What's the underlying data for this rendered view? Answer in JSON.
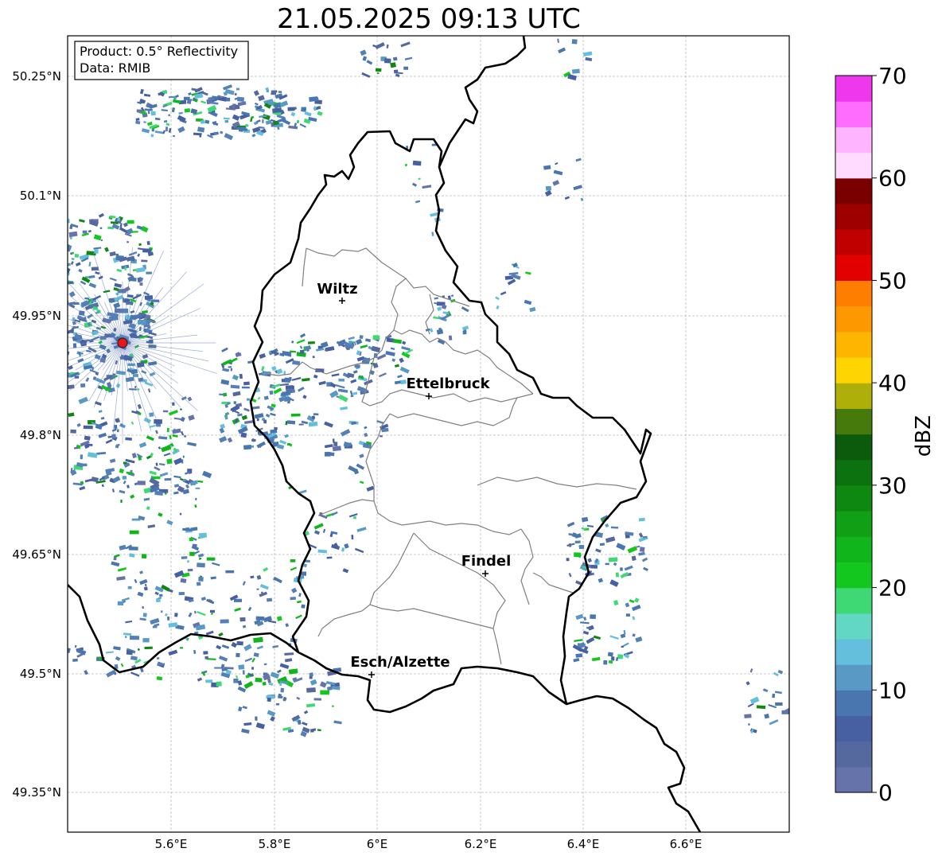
{
  "title": "21.05.2025 09:13 UTC",
  "info_box": {
    "product": "Product: 0.5° Reflectivity",
    "data": "Data: RMIB"
  },
  "lat_ticks": [
    "50.25°N",
    "50.1°N",
    "49.95°N",
    "49.8°N",
    "49.65°N",
    "49.5°N",
    "49.35°N"
  ],
  "lon_ticks": [
    "5.6°E",
    "5.8°E",
    "6°E",
    "6.2°E",
    "6.4°E",
    "6.6°E"
  ],
  "cities": [
    {
      "name": "Wiltz"
    },
    {
      "name": "Ettelbruck"
    },
    {
      "name": "Findel"
    },
    {
      "name": "Esch/Alzette"
    }
  ],
  "colorbar": {
    "label": "dBZ",
    "ticks": [
      "0",
      "10",
      "20",
      "30",
      "40",
      "50",
      "60",
      "70"
    ],
    "colors": [
      "#6673aa",
      "#56699f",
      "#4760a2",
      "#4a76b0",
      "#5899c6",
      "#64bfdc",
      "#61d7c4",
      "#3ed874",
      "#13c71f",
      "#10b51b",
      "#109f15",
      "#0f8812",
      "#0b720f",
      "#0c5b0c",
      "#467a0c",
      "#aeb009",
      "#fed500",
      "#fdb500",
      "#fe9800",
      "#fe7e00",
      "#e20000",
      "#c00000",
      "#9e0000",
      "#7a0000",
      "#ffdcff",
      "#ffb4ff",
      "#ff6dff",
      "#ee38ee"
    ]
  },
  "colors": {
    "border": "#000000",
    "cantons": "#808080",
    "radar_site": "#e8151b"
  }
}
